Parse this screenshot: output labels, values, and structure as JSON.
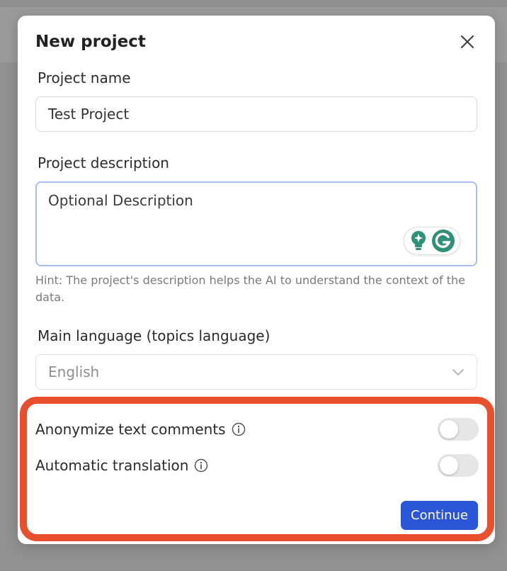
{
  "modal": {
    "title": "New project",
    "close_icon": "close-icon"
  },
  "form": {
    "project_name": {
      "label": "Project name",
      "value": "Test Project"
    },
    "project_description": {
      "label": "Project description",
      "value": "Optional Description",
      "hint": "Hint: The project's description helps the AI to understand the context of the data."
    },
    "main_language": {
      "label": "Main language (topics language)",
      "selected": "English",
      "icon": "chevron-down-icon"
    },
    "toggles": [
      {
        "label": "Anonymize text comments",
        "on": false,
        "info_icon": "info-icon"
      },
      {
        "label": "Automatic translation",
        "on": false,
        "info_icon": "info-icon"
      }
    ],
    "continue_label": "Continue"
  },
  "grammarly": {
    "icons": [
      "lightbulb-icon",
      "grammarly-icon"
    ]
  },
  "colors": {
    "accent": "#2a55d6",
    "highlight": "#e8502d",
    "focus_border": "#a9bdf3",
    "grammarly_green": "#2f8f79"
  }
}
